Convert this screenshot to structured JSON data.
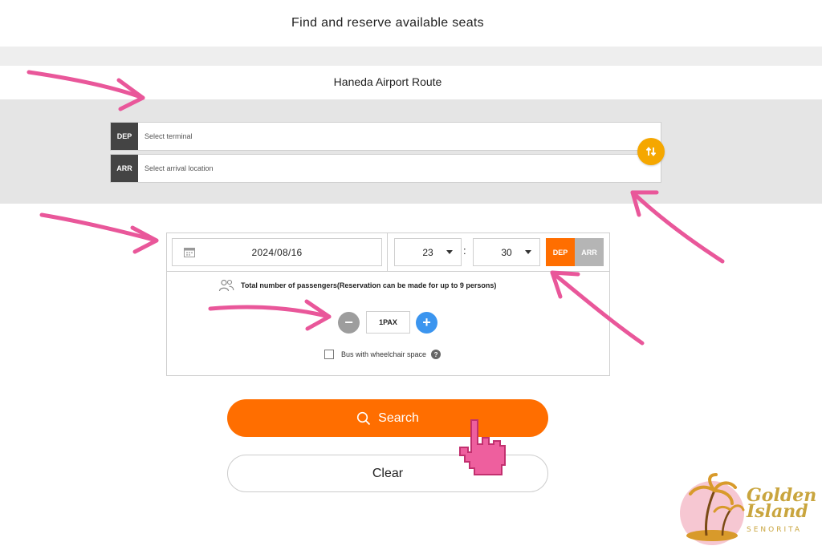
{
  "header": {
    "title": "Find and reserve available seats"
  },
  "route": {
    "title": "Haneda Airport Route"
  },
  "locations": {
    "dep_tag": "DEP",
    "dep_placeholder": "Select terminal",
    "arr_tag": "ARR",
    "arr_placeholder": "Select arrival location",
    "swap_icon": "swap-vertical-arrows"
  },
  "datetime": {
    "date": "2024/08/16",
    "hour": "23",
    "minute": "30",
    "separator": ":",
    "mode_dep": "DEP",
    "mode_arr": "ARR",
    "selected_mode": "DEP"
  },
  "passengers": {
    "label": "Total number of passengers(Reservation can be made for up to 9 persons)",
    "value": "1PAX",
    "minus_symbol": "−",
    "plus_symbol": "+"
  },
  "wheelchair": {
    "label": "Bus with wheelchair space",
    "checked": false,
    "help_symbol": "?"
  },
  "actions": {
    "search_label": "Search",
    "clear_label": "Clear"
  },
  "watermark": {
    "line1": "Golden",
    "line2": "Island",
    "line3": "SENORITA"
  },
  "colors": {
    "accent_orange": "#ff6e00",
    "swap_yellow": "#f5a700",
    "plus_blue": "#3b95ef",
    "annotation_pink": "#e9579a"
  }
}
